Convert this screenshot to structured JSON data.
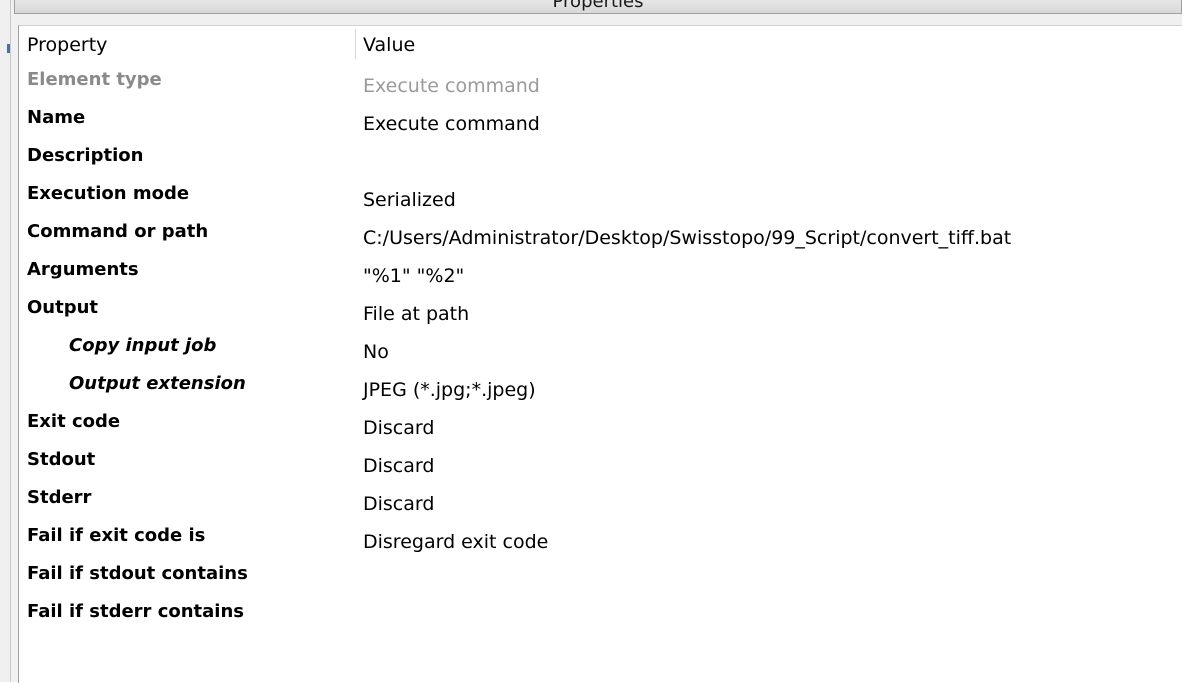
{
  "panel": {
    "title": "Properties"
  },
  "columns": {
    "property": "Property",
    "value": "Value"
  },
  "rows": [
    {
      "property": "Element type",
      "value": "Execute command",
      "muted": true,
      "indent": false
    },
    {
      "property": "Name",
      "value": "Execute command",
      "muted": false,
      "indent": false
    },
    {
      "property": "Description",
      "value": "",
      "muted": false,
      "indent": false
    },
    {
      "property": "Execution mode",
      "value": "Serialized",
      "muted": false,
      "indent": false
    },
    {
      "property": "Command or path",
      "value": "C:/Users/Administrator/Desktop/Swisstopo/99_Script/convert_tiff.bat",
      "muted": false,
      "indent": false
    },
    {
      "property": "Arguments",
      "value": "\"%1\" \"%2\"",
      "muted": false,
      "indent": false
    },
    {
      "property": "Output",
      "value": "File at path",
      "muted": false,
      "indent": false
    },
    {
      "property": "Copy input job",
      "value": "No",
      "muted": false,
      "indent": true
    },
    {
      "property": "Output extension",
      "value": "JPEG (*.jpg;*.jpeg)",
      "muted": false,
      "indent": true
    },
    {
      "property": "Exit code",
      "value": "Discard",
      "muted": false,
      "indent": false
    },
    {
      "property": "Stdout",
      "value": "Discard",
      "muted": false,
      "indent": false
    },
    {
      "property": "Stderr",
      "value": "Discard",
      "muted": false,
      "indent": false
    },
    {
      "property": "Fail if exit code is",
      "value": "Disregard exit code",
      "muted": false,
      "indent": false
    },
    {
      "property": "Fail if stdout contains",
      "value": "",
      "muted": false,
      "indent": false
    },
    {
      "property": "Fail if stderr contains",
      "value": "",
      "muted": false,
      "indent": false
    }
  ]
}
